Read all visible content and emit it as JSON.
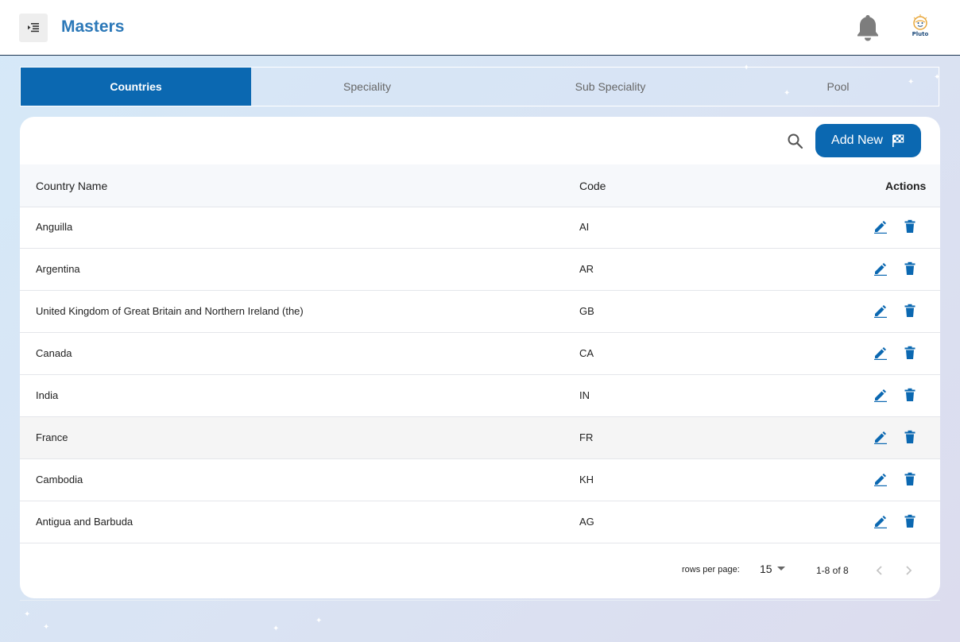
{
  "header": {
    "title": "Masters",
    "avatar_text": "Pluto"
  },
  "tabs": [
    {
      "label": "Countries",
      "active": true
    },
    {
      "label": "Speciality",
      "active": false
    },
    {
      "label": "Sub Speciality",
      "active": false
    },
    {
      "label": "Pool",
      "active": false
    }
  ],
  "toolbar": {
    "add_label": "Add New"
  },
  "table": {
    "columns": [
      "Country Name",
      "Code",
      "Actions"
    ],
    "rows": [
      {
        "name": "Anguilla",
        "code": "AI"
      },
      {
        "name": "Argentina",
        "code": "AR"
      },
      {
        "name": "United Kingdom of Great Britain and Northern Ireland (the)",
        "code": "GB"
      },
      {
        "name": "Canada",
        "code": "CA"
      },
      {
        "name": "India",
        "code": "IN"
      },
      {
        "name": "France",
        "code": "FR"
      },
      {
        "name": "Cambodia",
        "code": "KH"
      },
      {
        "name": "Antigua and Barbuda",
        "code": "AG"
      }
    ]
  },
  "pagination": {
    "rows_per_page_label": "rows per page:",
    "rows_per_page": "15",
    "range": "1-8 of 8"
  },
  "colors": {
    "primary": "#0b68b1",
    "title": "#2b78b8"
  },
  "icons": {
    "menu": "menu-indent-icon",
    "bell": "bell-icon",
    "search": "search-icon",
    "add": "checkered-flag-icon",
    "edit": "pencil-icon",
    "delete": "trash-icon",
    "prev": "chevron-left-icon",
    "next": "chevron-right-icon"
  }
}
